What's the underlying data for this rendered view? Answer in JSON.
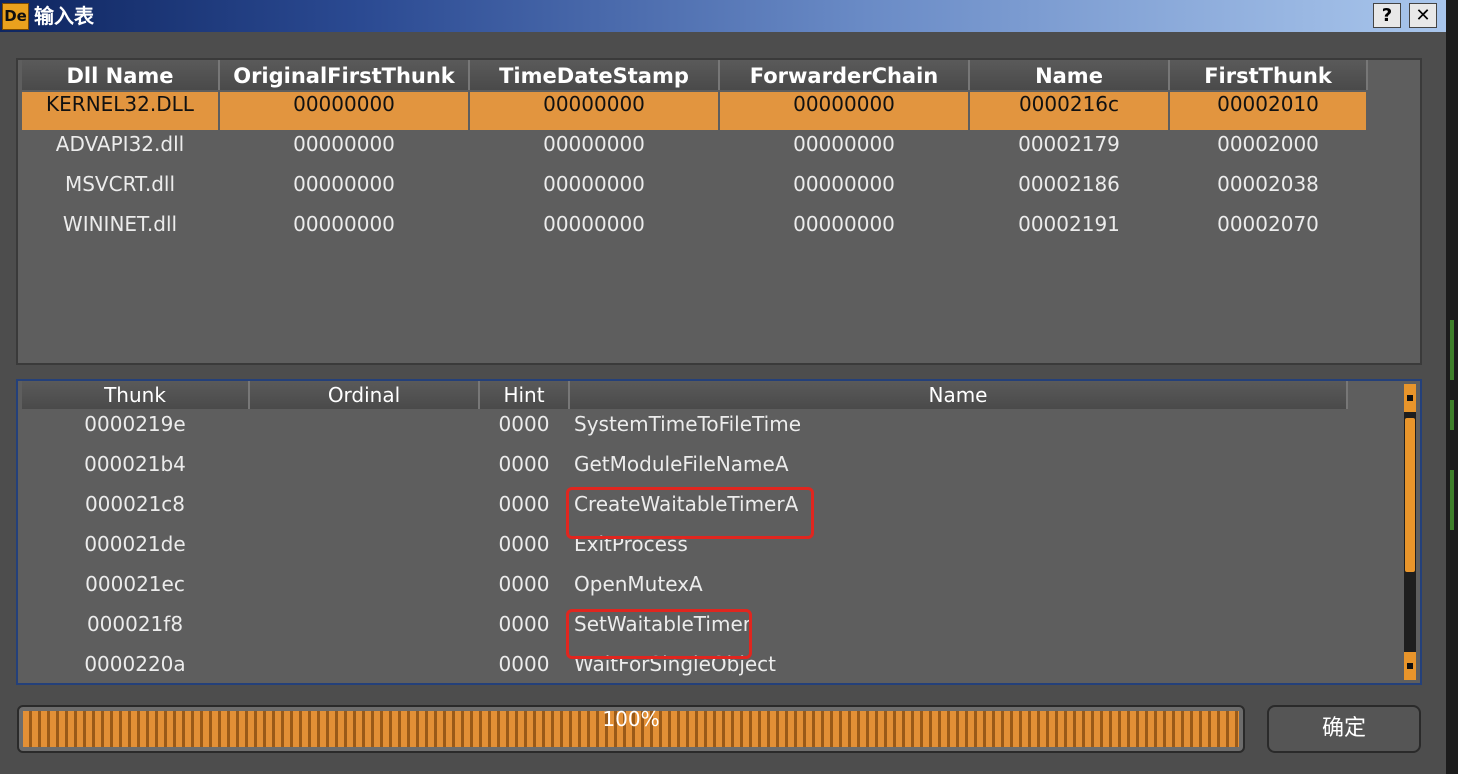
{
  "window": {
    "title": "输入表",
    "app_icon_text": "De",
    "help_label": "?",
    "close_label": "✕"
  },
  "dll_table": {
    "columns": [
      "Dll Name",
      "OriginalFirstThunk",
      "TimeDateStamp",
      "ForwarderChain",
      "Name",
      "FirstThunk"
    ],
    "rows": [
      [
        "KERNEL32.DLL",
        "00000000",
        "00000000",
        "00000000",
        "0000216c",
        "00002010"
      ],
      [
        "ADVAPI32.dll",
        "00000000",
        "00000000",
        "00000000",
        "00002179",
        "00002000"
      ],
      [
        "MSVCRT.dll",
        "00000000",
        "00000000",
        "00000000",
        "00002186",
        "00002038"
      ],
      [
        "WININET.dll",
        "00000000",
        "00000000",
        "00000000",
        "00002191",
        "00002070"
      ]
    ],
    "selected_row": 0
  },
  "thunk_table": {
    "columns": [
      "Thunk",
      "Ordinal",
      "Hint",
      "Name"
    ],
    "rows": [
      [
        "0000219e",
        "",
        "0000",
        "SystemTimeToFileTime"
      ],
      [
        "000021b4",
        "",
        "0000",
        "GetModuleFileNameA"
      ],
      [
        "000021c8",
        "",
        "0000",
        "CreateWaitableTimerA"
      ],
      [
        "000021de",
        "",
        "0000",
        "ExitProcess"
      ],
      [
        "000021ec",
        "",
        "0000",
        "OpenMutexA"
      ],
      [
        "000021f8",
        "",
        "0000",
        "SetWaitableTimer"
      ],
      [
        "0000220a",
        "",
        "0000",
        "WaitForSingleObject"
      ]
    ],
    "highlighted_rows": [
      2,
      5
    ]
  },
  "progress": {
    "label": "100%",
    "value": 1.0
  },
  "ok_button": {
    "label": "确定"
  },
  "colors": {
    "accent_orange": "#e2953f",
    "highlight_red": "#e0261f",
    "panel_bg": "#5e5e5e"
  }
}
